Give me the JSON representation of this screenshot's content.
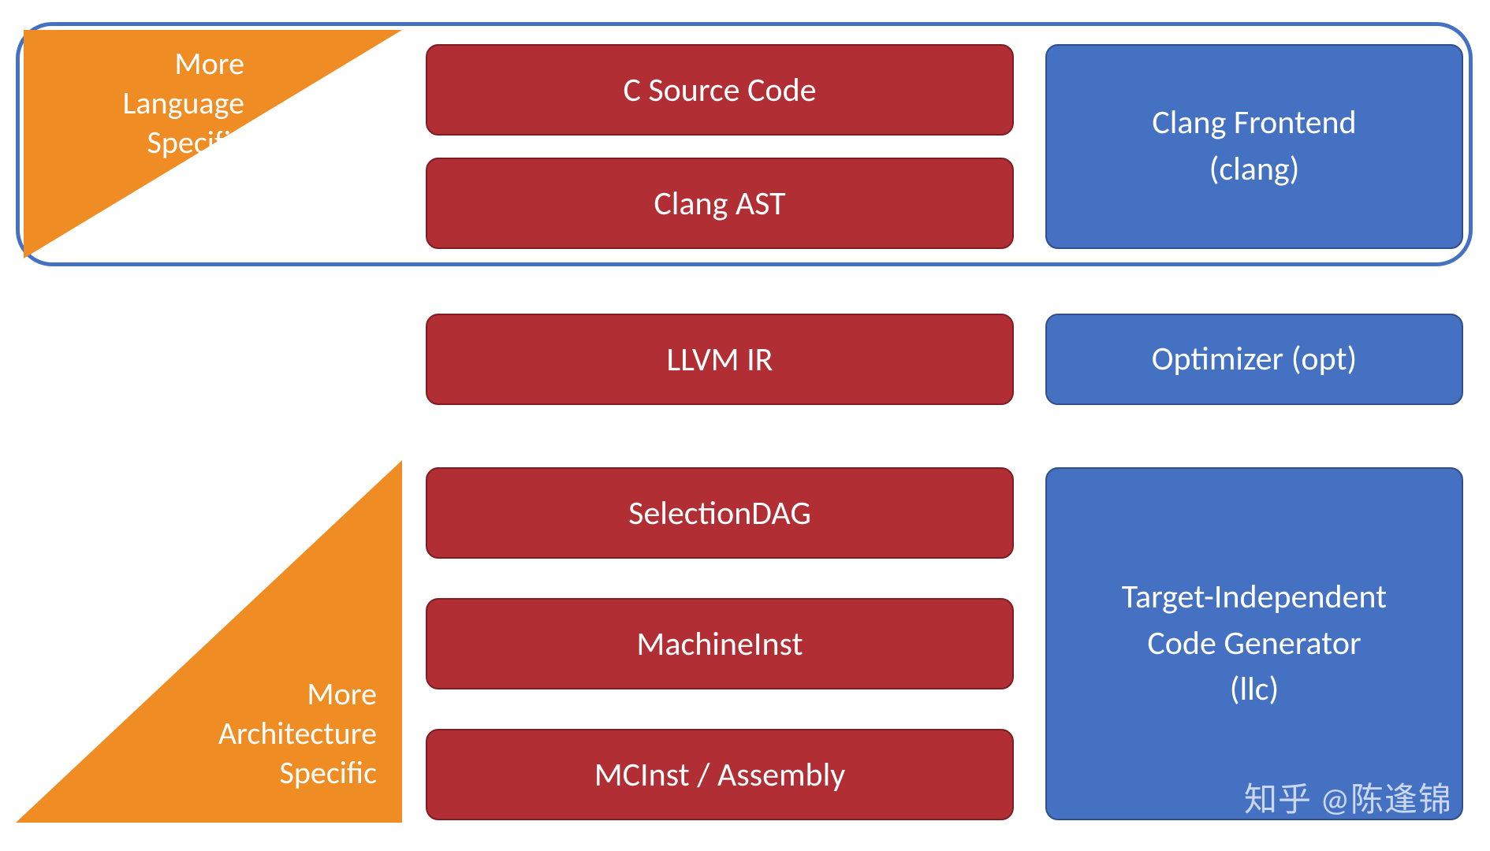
{
  "triangles": {
    "top": {
      "line1": "More",
      "line2": "Language",
      "line3": "Specific"
    },
    "bottom": {
      "line1": "More",
      "line2": "Architecture",
      "line3": "Specific"
    }
  },
  "stages": {
    "c_source": "C Source Code",
    "clang_ast": "Clang AST",
    "llvm_ir": "LLVM IR",
    "selection_dag": "SelectionDAG",
    "machine_inst": "MachineInst",
    "mcinst_asm": "MCInst / Assembly"
  },
  "phases": {
    "frontend": "Clang Frontend\n(clang)",
    "optimizer": "Optimizer (opt)",
    "codegen": "Target-Independent\nCode Generator\n(llc)"
  },
  "watermark": "知乎 @陈逢锦",
  "colors": {
    "orange": "#ef8c23",
    "red": "#b12e34",
    "blue": "#4571c3"
  }
}
